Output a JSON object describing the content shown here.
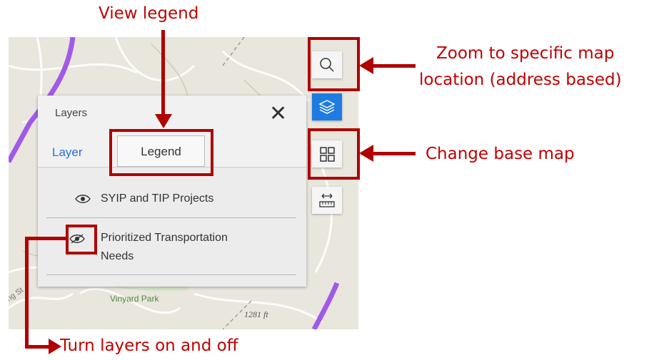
{
  "annotations": {
    "view_legend": "View legend",
    "zoom_line1": "Zoom to specific map",
    "zoom_line2": "location (address based)",
    "change_base": "Change base map",
    "turn_layers": "Turn layers on and off"
  },
  "map": {
    "park_label": "Vinyard Park",
    "elevation_label": "1281 ft",
    "road_label": "ing St"
  },
  "panel": {
    "title": "Layers",
    "close_glyph": "✕",
    "tabs": [
      {
        "label": "Layer"
      },
      {
        "label": "Legend"
      }
    ],
    "layers": [
      {
        "label": "SYIP and TIP Projects"
      },
      {
        "label_line1": "Prioritized Transportation",
        "label_line2": "Needs"
      }
    ]
  },
  "toolbar": {
    "search_icon": "search-icon",
    "layers_icon": "layers-icon",
    "basemap_icon": "basemap-gallery-icon",
    "measure_icon": "measure-icon"
  },
  "colors": {
    "accent": "#1e7be0",
    "annotation": "#c00000",
    "route": "#a05ae8"
  }
}
